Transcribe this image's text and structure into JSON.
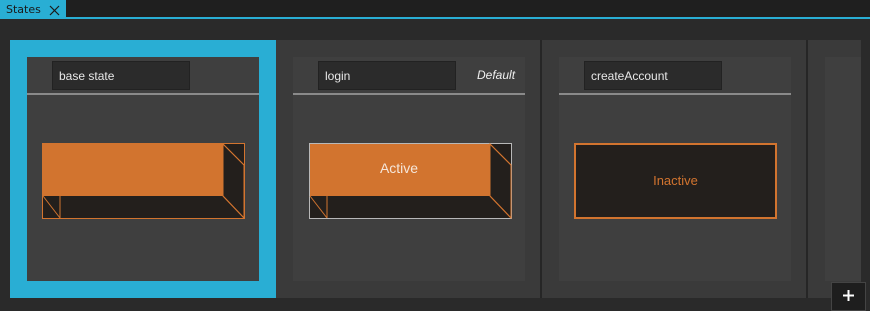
{
  "tab": {
    "label": "States"
  },
  "states": [
    {
      "name": "base state",
      "selected": true,
      "default_label": "",
      "preview_text": ""
    },
    {
      "name": "login",
      "selected": false,
      "default_label": "Default",
      "preview_text": "Active"
    },
    {
      "name": "createAccount",
      "selected": false,
      "default_label": "",
      "preview_text": "Inactive"
    }
  ],
  "colors": {
    "accent": "#29aed4",
    "orange": "#d2742f",
    "dark_fill": "#231f1c",
    "active_text": "#f5e6da",
    "inactive_text": "#d2742f"
  },
  "icons": {
    "tab_close": "close-icon",
    "add": "plus-icon"
  }
}
